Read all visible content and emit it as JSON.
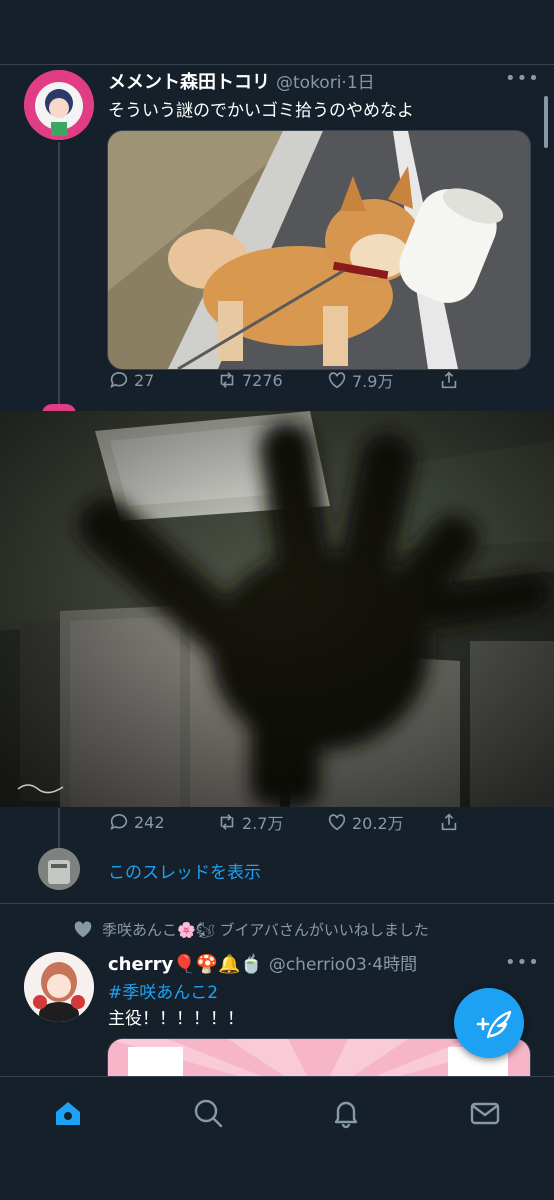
{
  "tweet1": {
    "name": "メメント森田トコリ",
    "handle": "@tokori",
    "time": "·1日",
    "text": "そういう謎のでかいゴミ拾うのやめなよ",
    "replies": "27",
    "retweets": "7276",
    "likes": "7.9万"
  },
  "tweet2": {
    "replies": "242",
    "retweets": "2.7万",
    "likes": "20.2万",
    "show_thread": "このスレッドを表示"
  },
  "tweet3": {
    "social_context": "季咲あんこ🌸🐿 ブイアバさんがいいねしました",
    "name": "cherry🎈🍄🔔🍵",
    "handle": "@cherrio03",
    "time": "·4時間",
    "hashtag": "#季咲あんこ2",
    "text": "主役！！！！！！"
  },
  "more_glyph": "•••",
  "colors": {
    "background": "#15202b",
    "accent": "#1da1f2",
    "secondary_text": "#8899a6",
    "divider": "#38444d"
  },
  "nav": {
    "items": [
      "home-icon",
      "search-icon",
      "notifications-icon",
      "messages-icon"
    ]
  }
}
